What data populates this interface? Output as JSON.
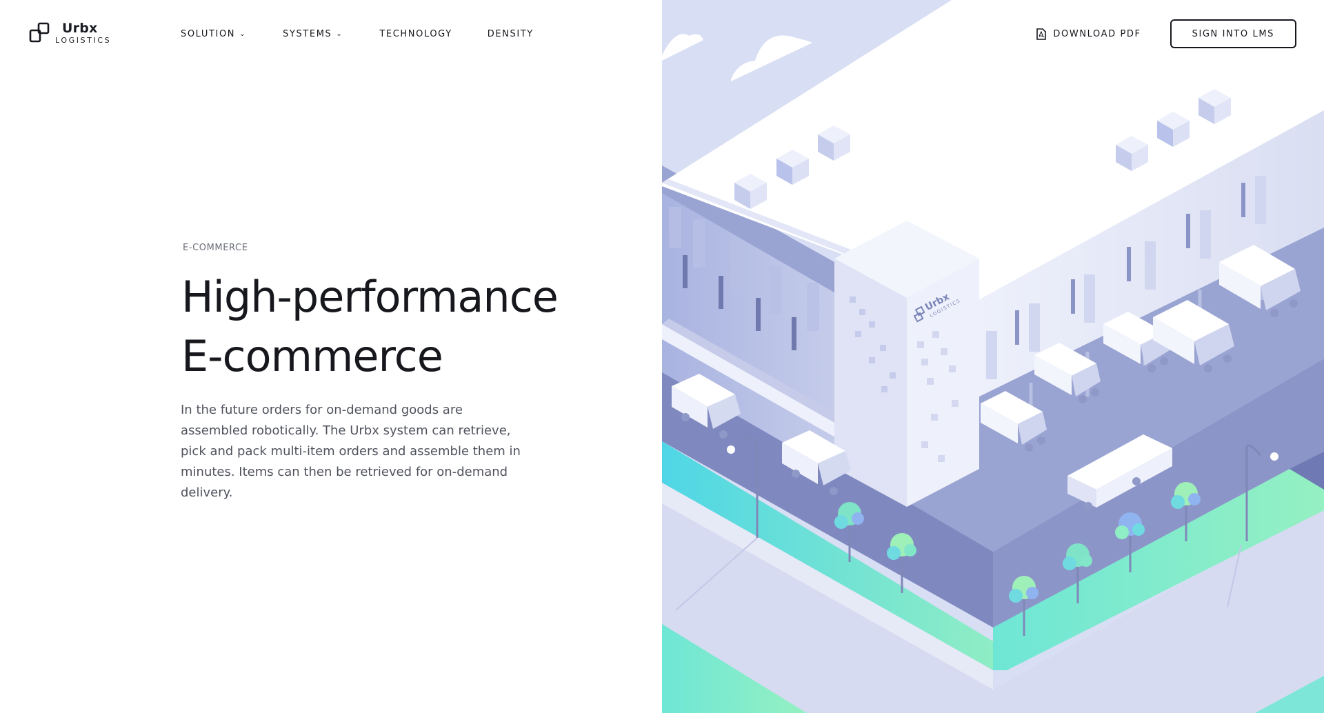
{
  "brand": {
    "name": "Urbx",
    "sub": "LOGISTICS"
  },
  "nav": {
    "items": [
      {
        "label": "SOLUTION",
        "has_dropdown": true
      },
      {
        "label": "SYSTEMS",
        "has_dropdown": true
      },
      {
        "label": "TECHNOLOGY",
        "has_dropdown": false
      },
      {
        "label": "DENSITY",
        "has_dropdown": false
      }
    ]
  },
  "actions": {
    "download_label": "DOWNLOAD PDF",
    "download_icon": "pdf-file-icon",
    "signin_label": "SIGN INTO LMS"
  },
  "hero": {
    "eyebrow": "E-COMMERCE",
    "title_line1": "High-performance",
    "title_line2": "E-commerce",
    "body": "In the future orders for on-demand goods are assembled robotically. The Urbx system can retrieve, pick and pack multi-item orders and assemble them in minutes. Items can then be retrieved for on-demand delivery."
  },
  "illustration": {
    "building_logo_name": "Urbx",
    "building_logo_sub": "LOGISTICS"
  },
  "colors": {
    "sky": "#d8def3",
    "teal": "#4fd6e3",
    "mint": "#8fedc4",
    "road": "#8e98c6"
  }
}
